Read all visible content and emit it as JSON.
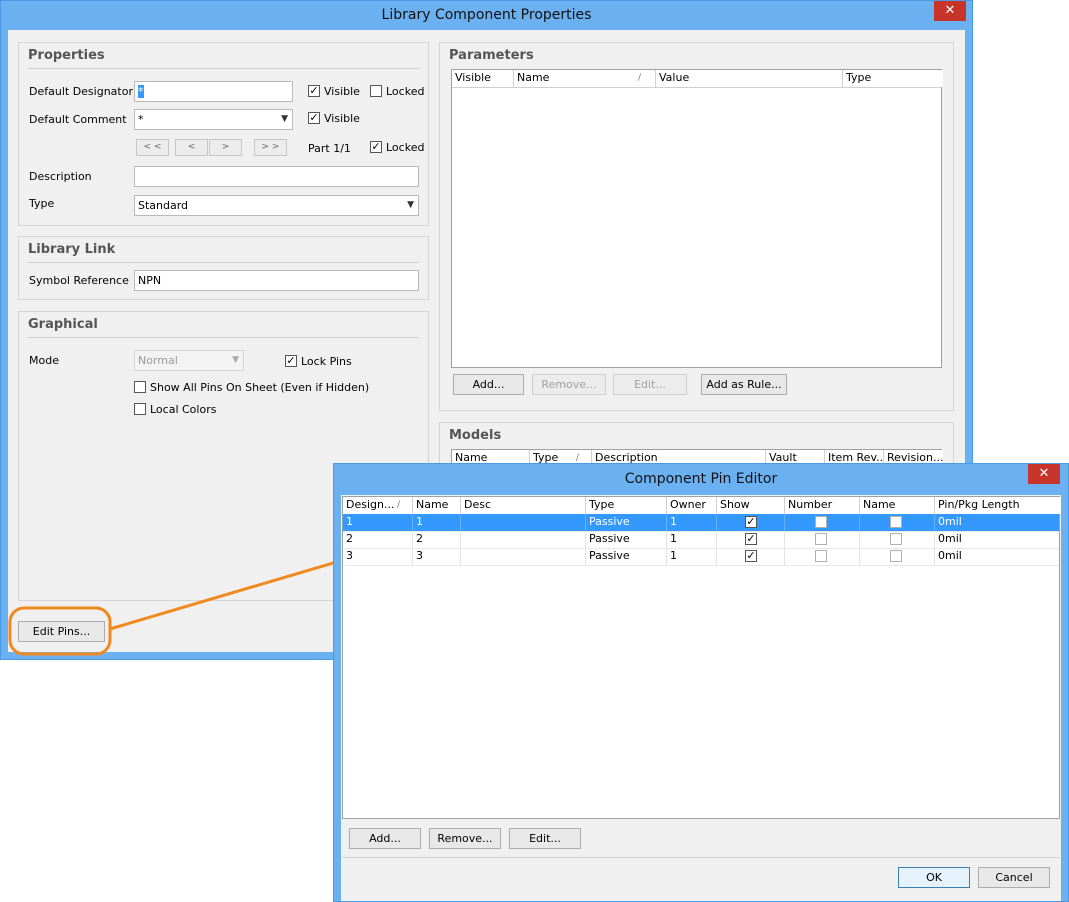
{
  "main_window": {
    "title": "Library Component Properties",
    "close": "✕",
    "properties": {
      "title": "Properties",
      "default_designator_label": "Default Designator",
      "default_designator_value": "*",
      "visible_label": "Visible",
      "locked_label": "Locked",
      "default_comment_label": "Default Comment",
      "default_comment_value": "*",
      "nav": [
        "< <",
        "<",
        ">",
        "> >"
      ],
      "part_label": "Part 1/1",
      "description_label": "Description",
      "description_value": "",
      "type_label": "Type",
      "type_value": "Standard"
    },
    "library_link": {
      "title": "Library Link",
      "symbol_reference_label": "Symbol Reference",
      "symbol_reference_value": "NPN"
    },
    "graphical": {
      "title": "Graphical",
      "mode_label": "Mode",
      "mode_value": "Normal",
      "lock_pins_label": "Lock Pins",
      "show_all_pins_label": "Show All Pins On Sheet (Even if Hidden)",
      "local_colors_label": "Local Colors"
    },
    "parameters": {
      "title": "Parameters",
      "columns": [
        "Visible",
        "Name",
        "/",
        "Value",
        "Type"
      ],
      "buttons": {
        "add": "Add...",
        "remove": "Remove...",
        "edit": "Edit...",
        "add_as_rule": "Add as Rule..."
      }
    },
    "models": {
      "title": "Models",
      "columns": [
        "Name",
        "Type",
        "/",
        "Description",
        "Vault",
        "Item Rev...",
        "Revision..."
      ]
    },
    "edit_pins_button": "Edit Pins..."
  },
  "pin_editor": {
    "title": "Component Pin Editor",
    "close": "✕",
    "columns": [
      "Design...",
      "/",
      "Name",
      "Desc",
      "Type",
      "Owner",
      "Show",
      "Number",
      "Name",
      "Pin/Pkg Length"
    ],
    "rows": [
      {
        "designator": "1",
        "name": "1",
        "desc": "",
        "type": "Passive",
        "owner": "1",
        "show": true,
        "number": false,
        "name_chk": false,
        "length": "0mil"
      },
      {
        "designator": "2",
        "name": "2",
        "desc": "",
        "type": "Passive",
        "owner": "1",
        "show": true,
        "number": false,
        "name_chk": false,
        "length": "0mil"
      },
      {
        "designator": "3",
        "name": "3",
        "desc": "",
        "type": "Passive",
        "owner": "1",
        "show": true,
        "number": false,
        "name_chk": false,
        "length": "0mil"
      }
    ],
    "buttons": {
      "add": "Add...",
      "remove": "Remove...",
      "edit": "Edit...",
      "ok": "OK",
      "cancel": "Cancel"
    }
  },
  "colors": {
    "title_bar": "#6bb1f2",
    "close": "#c7342a",
    "selection": "#3399ff",
    "callout": "#f0891e"
  }
}
